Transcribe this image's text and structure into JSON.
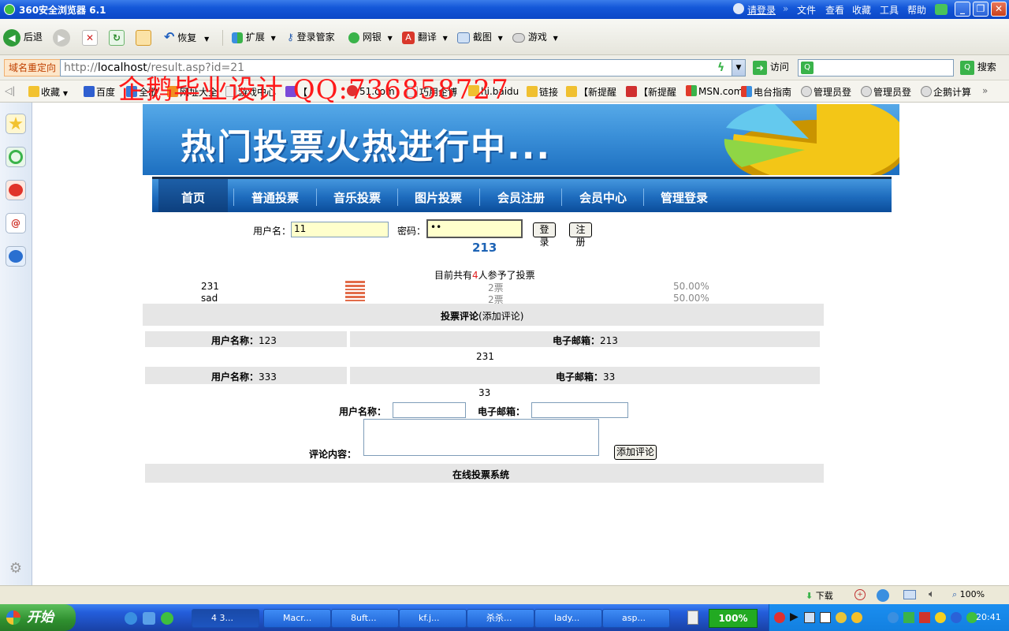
{
  "window": {
    "title": "360安全浏览器 6.1",
    "login_link": "请登录",
    "menu": [
      "文件",
      "查看",
      "收藏",
      "工具",
      "帮助"
    ]
  },
  "toolbar": {
    "back": "后退",
    "restore": "恢复",
    "extend": "扩展",
    "login_manager": "登录管家",
    "bank": "网银",
    "translate": "翻译",
    "screenshot": "截图",
    "games": "游戏"
  },
  "addressbar": {
    "label": "域名重定向",
    "url_prefix": "http://",
    "url_host": "localhost",
    "url_path": "/result.asp?id=21",
    "visit": "访问",
    "search": "搜索"
  },
  "favorites": [
    "收藏",
    "百度",
    "全歌",
    "网址大全",
    "游戏中心",
    "【",
    "51.com",
    "巧用企博",
    "hi.baidu",
    "链接",
    "【新提醒",
    "【新提醒",
    "MSN.com",
    "电台指南",
    "管理员登",
    "管理员登",
    "企鹅计算"
  ],
  "watermark": "企鹅毕业设计 QQ:736858727",
  "banner": {
    "title": "热门投票火热进行中..."
  },
  "nav": [
    "首页",
    "普通投票",
    "音乐投票",
    "图片投票",
    "会员注册",
    "会员中心",
    "管理登录"
  ],
  "login": {
    "username_label": "用户名：",
    "username_value": "11",
    "password_label": "密码：",
    "password_value": "••",
    "login_btn": "登录",
    "register_btn": "注册"
  },
  "vote": {
    "title": "213",
    "summary_prefix": "目前共有",
    "summary_count": "4",
    "summary_suffix": "人参予了投票",
    "options": [
      {
        "name": "231",
        "votes": "2票",
        "percent": "50.00%",
        "share": 0.5
      },
      {
        "name": "sad",
        "votes": "2票",
        "percent": "50.00%",
        "share": 0.5
      }
    ]
  },
  "comments": {
    "header": "投票评论",
    "add_link": "(添加评论)",
    "user_label": "用户名称：",
    "email_label": "电子邮箱：",
    "items": [
      {
        "user": "123",
        "email": "213",
        "content": "231"
      },
      {
        "user": "333",
        "email": "33",
        "content": "33"
      }
    ],
    "form": {
      "user_label": "用户名称：",
      "email_label": "电子邮箱：",
      "content_label": "评论内容：",
      "submit": "添加评论"
    }
  },
  "footer": "在线投票系统",
  "statusbar": {
    "download": "下载",
    "zoom": "100%"
  },
  "taskbar": {
    "start": "开始",
    "tasks": [
      "4 3...",
      "Macr...",
      "8uft...",
      "kf.j...",
      "杀杀...",
      "lady...",
      "asp..."
    ],
    "zoom_badge": "100%",
    "clock": "20:41"
  }
}
